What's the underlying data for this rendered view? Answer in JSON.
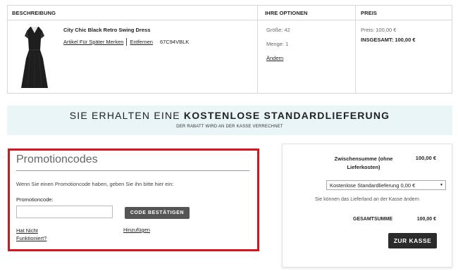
{
  "cart": {
    "headers": {
      "description": "BESCHREIBUNG",
      "options": "IHRE OPTIONEN",
      "price": "PREIS"
    },
    "item": {
      "name": "City Chic Black Retro Swing Dress",
      "save_later": "Artikel Für Später Merken",
      "remove": "Entfernen",
      "sku": "67C94VBLK",
      "size": "Größe: 42",
      "quantity": "Menge: 1",
      "change": "Ändern",
      "price": "Preis: 100,00 €",
      "total": "INSGESAMT:  100,00 €"
    }
  },
  "banner": {
    "title_prefix": "SIE ERHALTEN EINE",
    "title_bold": "KOSTENLOSE STANDARDLIEFERUNG",
    "subtitle": "DER RABATT WIRD AN DER KASSE VERRECHNET"
  },
  "promo": {
    "title": "Promotioncodes",
    "instruction": "Wenn Sie einen Promotioncode haben, geben Sie ihn bitte hier ein:",
    "label": "Promotioncode:",
    "input_value": "",
    "button": "CODE BESTÄTIGEN",
    "not_working": "Hat Nicht Funktioniert?",
    "add": "Hinzufügen"
  },
  "summary": {
    "subtotal_label": "Zwischensumme (ohne Lieferkosten)",
    "subtotal_value": "100,00 €",
    "shipping_option": "Kostenlose Standardlieferung 0,00 €",
    "note": "Sie können das Lieferland an der Kasse ändern",
    "total_label": "GESAMTSUMME",
    "total_value": "100,00 €",
    "checkout": "ZUR KASSE"
  },
  "colors": {
    "promo_border": "#d9141a",
    "banner_bg": "#e9f5f7",
    "checkout_bg": "#2b2b2b",
    "code_button_bg": "#555555"
  }
}
